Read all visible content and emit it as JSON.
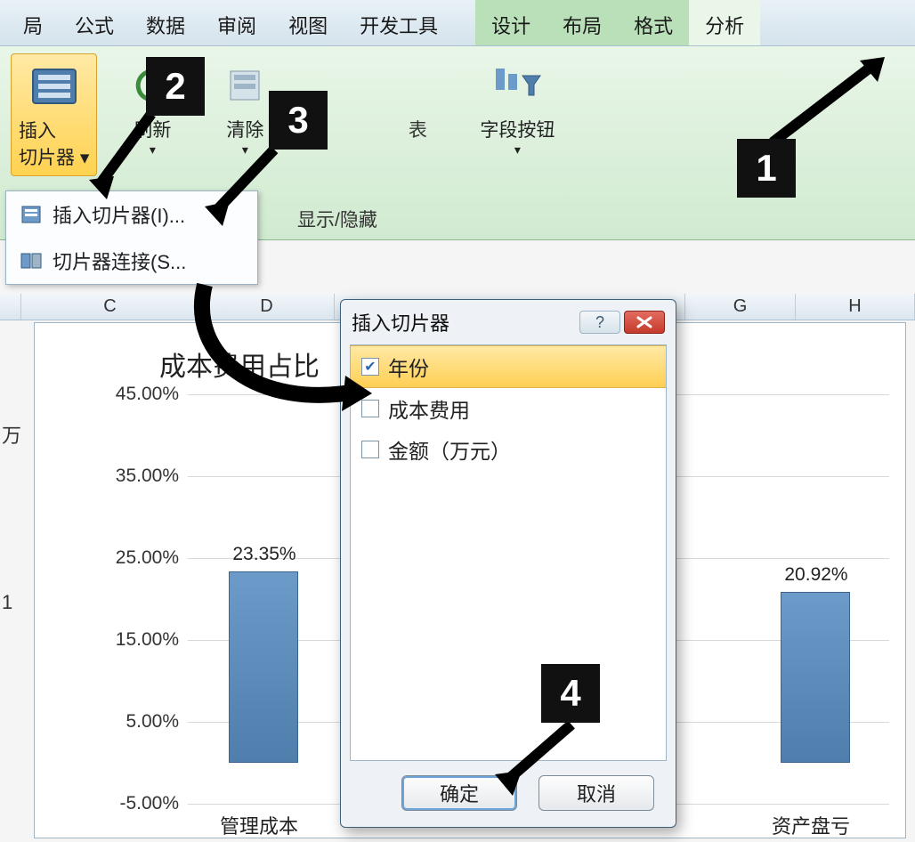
{
  "ribbon": {
    "tabs": [
      "局",
      "公式",
      "数据",
      "审阅",
      "视图",
      "开发工具",
      "设计",
      "布局",
      "格式",
      "分析"
    ],
    "active_tab_index": 9,
    "buttons": {
      "insert_slicer": "插入\n切片器",
      "refresh": "刷新",
      "clear": "清除",
      "table_partial": "表",
      "field_buttons": "字段按钮"
    },
    "group_label_showhide": "显示/隐藏"
  },
  "dropdown": {
    "item1": "插入切片器(I)...",
    "item2": "切片器连接(S..."
  },
  "columns": {
    "c": "C",
    "d": "D",
    "g": "G",
    "h": "H"
  },
  "rows": {
    "r0": "万",
    "r1": "1"
  },
  "chart_data": {
    "type": "bar",
    "title": "成本费用占比",
    "ylabel": "",
    "ylim": [
      -5,
      45
    ],
    "yticks": [
      "45.00%",
      "35.00%",
      "25.00%",
      "15.00%",
      "5.00%",
      "-5.00%"
    ],
    "categories": [
      "管理成本",
      "资产盘亏"
    ],
    "values": [
      23.35,
      20.92
    ],
    "value_labels": [
      "23.35%",
      "20.92%"
    ]
  },
  "dialog": {
    "title": "插入切片器",
    "fields": [
      {
        "label": "年份",
        "checked": true
      },
      {
        "label": "成本费用",
        "checked": false
      },
      {
        "label": "金额（万元）",
        "checked": false
      }
    ],
    "ok": "确定",
    "cancel": "取消"
  },
  "steps": {
    "s1": "1",
    "s2": "2",
    "s3": "3",
    "s4": "4"
  }
}
